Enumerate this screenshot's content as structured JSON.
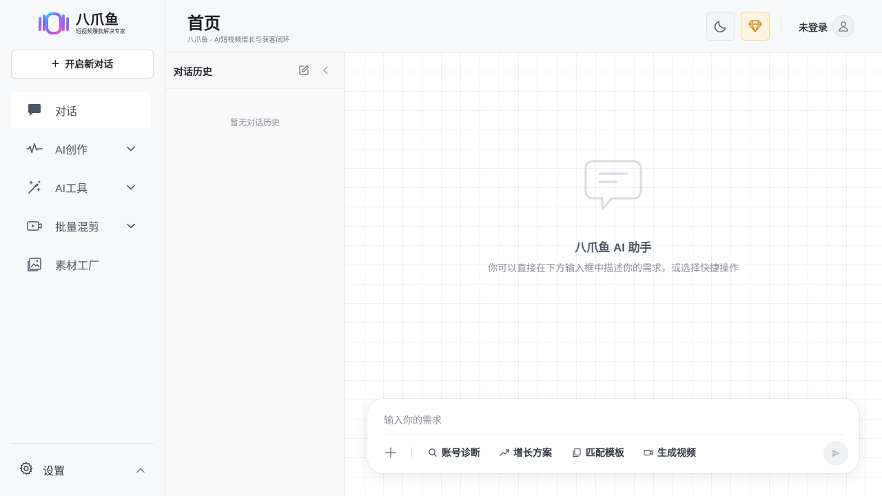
{
  "brand": {
    "name": "八爪鱼",
    "slogan": "短视频爆款解决专家",
    "logo_icon": "octopus-logo"
  },
  "sidebar": {
    "new_chat_label": "开启新对话",
    "items": [
      {
        "label": "对话",
        "icon": "chat-bubble-icon",
        "active": true,
        "expandable": false
      },
      {
        "label": "AI创作",
        "icon": "sparkle-wave-icon",
        "active": false,
        "expandable": true
      },
      {
        "label": "AI工具",
        "icon": "magic-wand-icon",
        "active": false,
        "expandable": true
      },
      {
        "label": "批量混剪",
        "icon": "video-clip-icon",
        "active": false,
        "expandable": true
      },
      {
        "label": "素材工厂",
        "icon": "image-gallery-icon",
        "active": false,
        "expandable": false
      }
    ],
    "settings_label": "设置"
  },
  "header": {
    "title": "首页",
    "subtitle": "八爪鱼 - AI短视频增长与获客闭环",
    "login_label": "未登录"
  },
  "history": {
    "title": "对话历史",
    "empty_text": "暂无对话历史"
  },
  "main": {
    "hero_title": "八爪鱼 AI 助手",
    "hero_desc": "你可以直接在下方输入框中描述你的需求，或选择快捷操作",
    "input_placeholder": "输入你的需求",
    "quick_actions": [
      {
        "label": "账号诊断",
        "icon": "search-icon"
      },
      {
        "label": "增长方案",
        "icon": "trend-up-icon"
      },
      {
        "label": "匹配模板",
        "icon": "copy-icon"
      },
      {
        "label": "生成视频",
        "icon": "video-camera-icon"
      }
    ]
  },
  "colors": {
    "accent_gold": "#d98a1c",
    "vip_bg": "#fdf3e0",
    "text_primary": "#1f2329",
    "text_muted": "#8a909a"
  }
}
